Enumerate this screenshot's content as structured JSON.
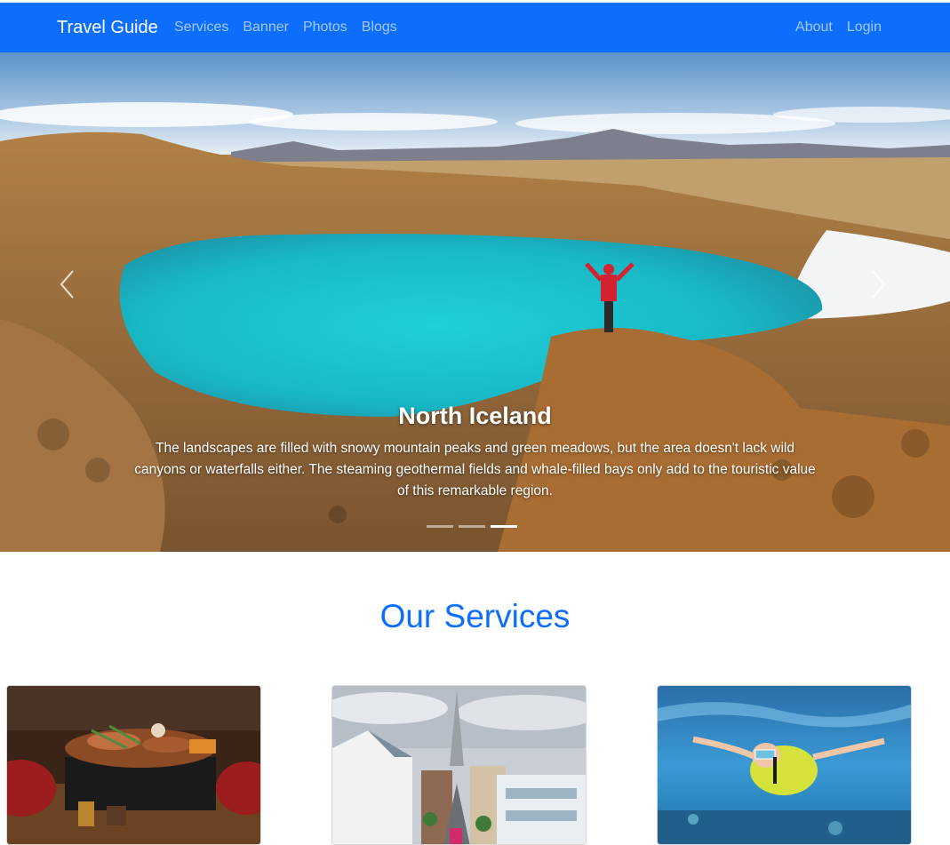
{
  "navbar": {
    "brand": "Travel Guide",
    "left_links": [
      "Services",
      "Banner",
      "Photos",
      "Blogs"
    ],
    "right_links": [
      "About",
      "Login"
    ],
    "bg_color": "#0d6efd"
  },
  "carousel": {
    "active_slide_title": "North Iceland",
    "active_slide_text": "The landscapes are filled with snowy mountain peaks and green meadows, but the area doesn't lack wild canyons or waterfalls either. The steaming geothermal fields and whale-filled bays only add to the touristic value of this remarkable region.",
    "prev_icon": "chevron-left-icon",
    "next_icon": "chevron-right-icon",
    "indicator_count": 3,
    "active_indicator": 3
  },
  "services": {
    "title": "Our Services",
    "cards": [
      {
        "image": "grilled-food-image"
      },
      {
        "image": "city-street-church-image"
      },
      {
        "image": "snorkeling-image"
      }
    ]
  }
}
